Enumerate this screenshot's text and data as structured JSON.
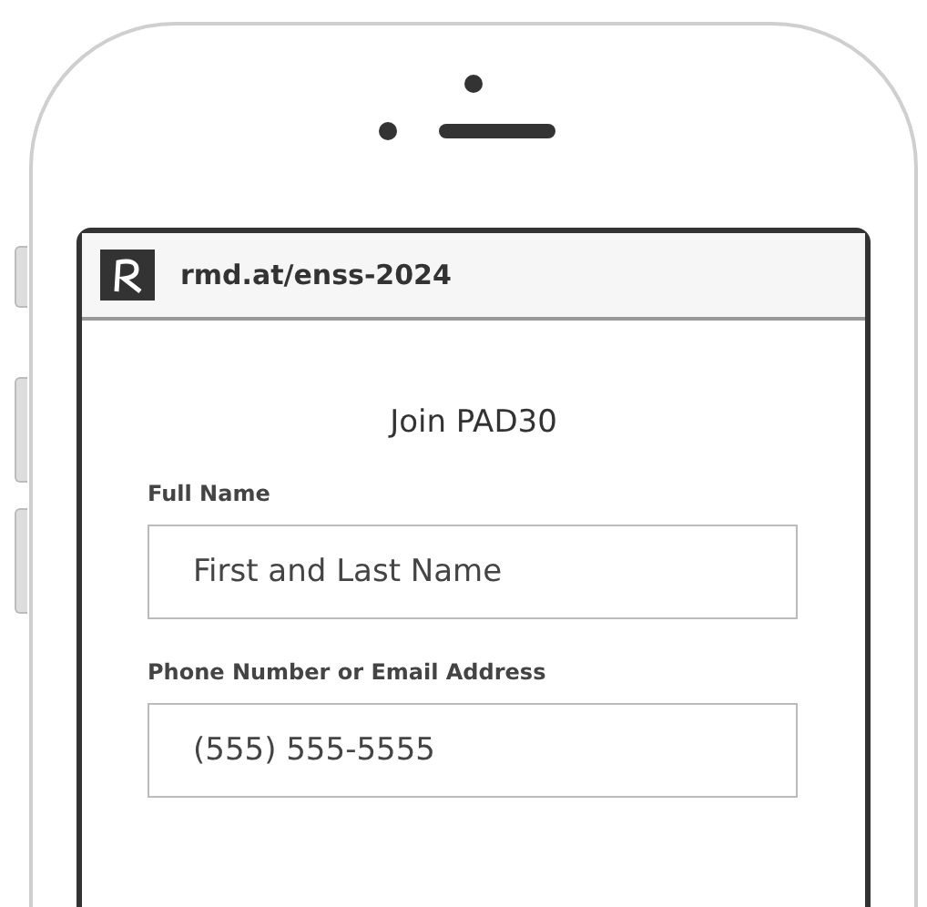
{
  "browser_bar": {
    "url": "rmd.at/enss-2024"
  },
  "form": {
    "title": "Join PAD30",
    "fields": [
      {
        "label": "Full Name",
        "placeholder": "First and Last Name"
      },
      {
        "label": "Phone Number or Email Address",
        "placeholder": "(555) 555-5555"
      }
    ]
  }
}
